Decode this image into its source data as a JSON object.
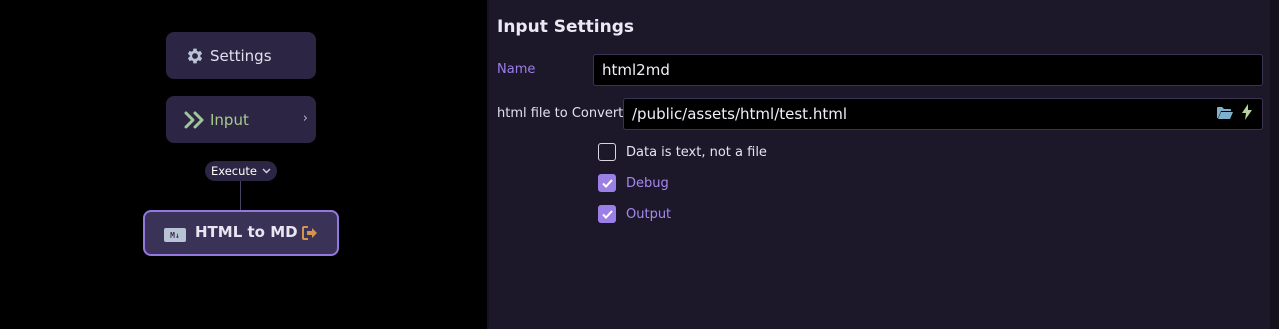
{
  "canvas": {
    "nodes": {
      "settings": {
        "label": "Settings",
        "icon": "gear-icon"
      },
      "input": {
        "label": "Input",
        "icon": "double-chevron-right-icon",
        "chevron": "›"
      },
      "execute": {
        "label": "Execute",
        "chevron": "⌄"
      },
      "html_to_md": {
        "label": "HTML to MD",
        "badge": "M↓",
        "icon": "exit-icon"
      }
    }
  },
  "panel": {
    "title": "Input Settings",
    "name": {
      "label": "Name",
      "value": "html2md"
    },
    "file": {
      "label": "html file to Convert",
      "value": "/public/assets/html/test.html"
    },
    "options": [
      {
        "label": "Data is text, not a file",
        "checked": false
      },
      {
        "label": "Debug",
        "checked": true
      },
      {
        "label": "Output",
        "checked": true
      }
    ]
  },
  "colors": {
    "accent": "#9b7fe6",
    "node_bg": "#2c2544",
    "input_label": "#a8c98f",
    "panel_bg": "#1c1829",
    "exit_icon": "#d4944a"
  }
}
